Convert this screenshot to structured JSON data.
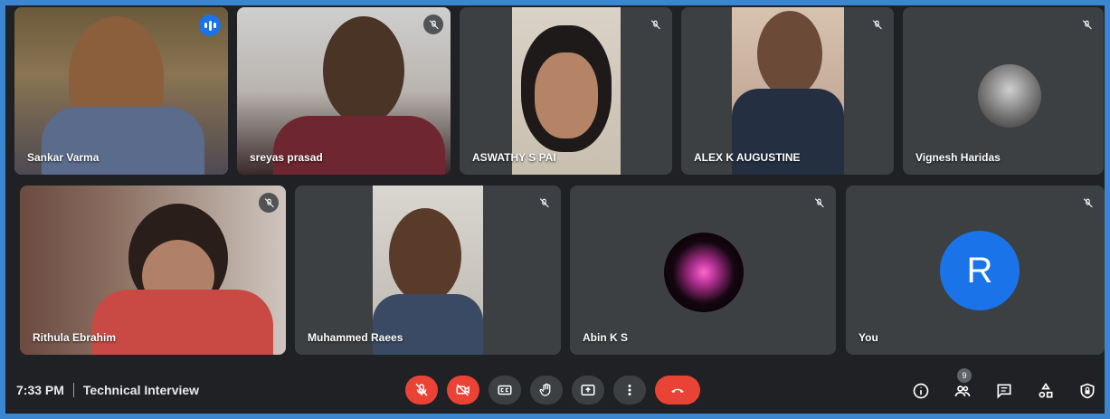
{
  "participants": [
    {
      "name": "Sankar Varma",
      "speaking": true
    },
    {
      "name": "sreyas prasad",
      "muted": true
    },
    {
      "name": "ASWATHY S PAI",
      "muted": true
    },
    {
      "name": "ALEX K AUGUSTINE",
      "muted": true
    },
    {
      "name": "Vignesh Haridas",
      "muted": true
    },
    {
      "name": "Rithula Ebrahim",
      "muted": true
    },
    {
      "name": "Muhammed Raees",
      "muted": true
    },
    {
      "name": "Abin K S",
      "muted": true
    },
    {
      "name": "You",
      "avatar_letter": "R",
      "avatar_color": "#1a73e8",
      "muted": true
    }
  ],
  "meeting": {
    "time": "7:33 PM",
    "title": "Technical Interview"
  },
  "toolbar": {
    "people_count": "9"
  },
  "colors": {
    "end_call": "#ea4335",
    "accent": "#1a73e8",
    "tile": "#3c4043",
    "background": "#202124"
  }
}
